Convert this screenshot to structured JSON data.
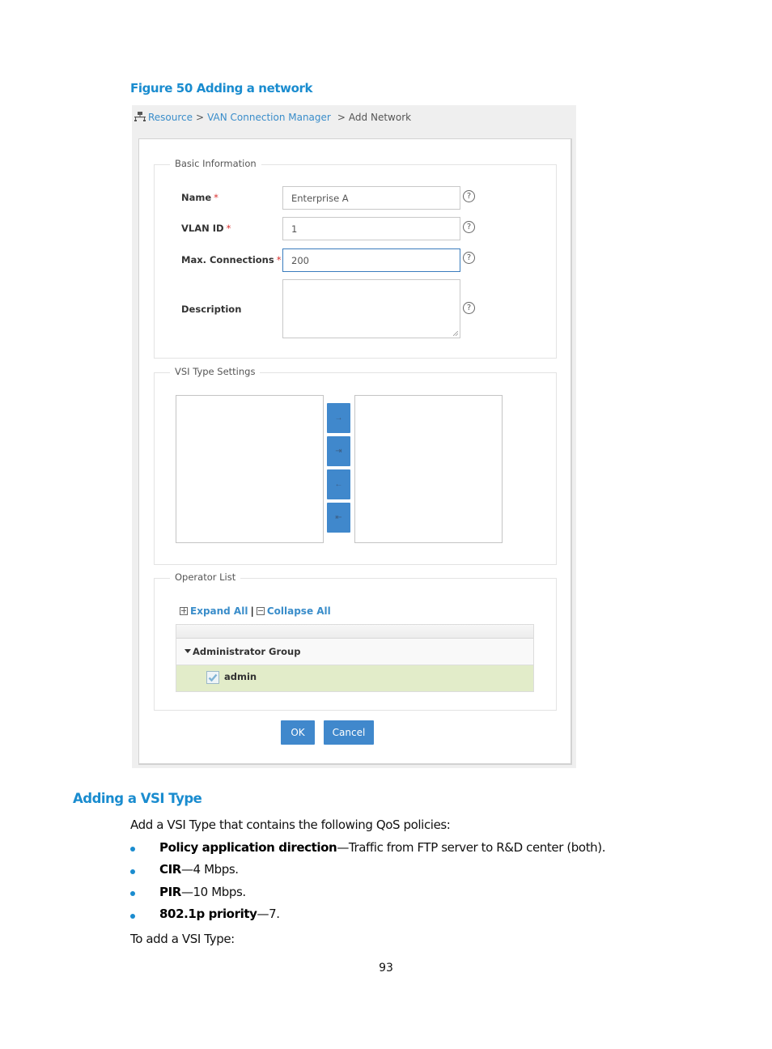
{
  "figure": {
    "caption": "Figure 50 Adding a network"
  },
  "breadcrumb": {
    "icon": "network-topology-icon",
    "items": [
      {
        "label": "Resource",
        "link": true
      },
      {
        "label": "VAN Connection Manager",
        "link": true
      },
      {
        "label": "Add Network",
        "link": false
      }
    ],
    "separator": ">"
  },
  "basic_info": {
    "legend": "Basic Information",
    "fields": [
      {
        "label": "Name",
        "required": true,
        "value": "Enterprise A",
        "help": "?"
      },
      {
        "label": "VLAN ID",
        "required": true,
        "value": "1",
        "help": "?"
      },
      {
        "label": "Max. Connections",
        "required": true,
        "value": "200",
        "help": "?",
        "focused": true
      },
      {
        "label": "Description",
        "required": false,
        "value": "",
        "help": "?"
      }
    ],
    "required_mark": "*"
  },
  "vsi_settings": {
    "legend": "VSI Type Settings",
    "available_items": [],
    "selected_items": [],
    "buttons": [
      {
        "name": "move-right",
        "glyph": "→"
      },
      {
        "name": "move-all-right",
        "glyph": "⇥"
      },
      {
        "name": "move-left",
        "glyph": "←"
      },
      {
        "name": "move-all-left",
        "glyph": "⇤"
      }
    ]
  },
  "operator_list": {
    "legend": "Operator List",
    "expand_all": "Expand All",
    "divider": "|",
    "collapse_all": "Collapse All",
    "groups": [
      {
        "name": "Administrator Group",
        "expanded": true,
        "operators": [
          {
            "name": "admin",
            "checked": true
          }
        ]
      }
    ]
  },
  "actions": {
    "ok": "OK",
    "cancel": "Cancel"
  },
  "document": {
    "section_title": "Adding a VSI Type",
    "intro": "Add a VSI Type that contains the following QoS policies:",
    "bullets": [
      {
        "term": "Policy application direction",
        "text": "—Traffic from FTP server to R&D center (both)."
      },
      {
        "term": "CIR",
        "text": "—4 Mbps."
      },
      {
        "term": "PIR",
        "text": "—10 Mbps."
      },
      {
        "term": "802.1p priority",
        "text": "—7."
      }
    ],
    "outro": "To add a VSI Type:",
    "page_number": "93"
  },
  "colors": {
    "accent": "#1a8ccf",
    "button": "#4088cc",
    "link": "#3a8dca",
    "selected_row": "#e2ecc9",
    "required": "#d9302e"
  }
}
